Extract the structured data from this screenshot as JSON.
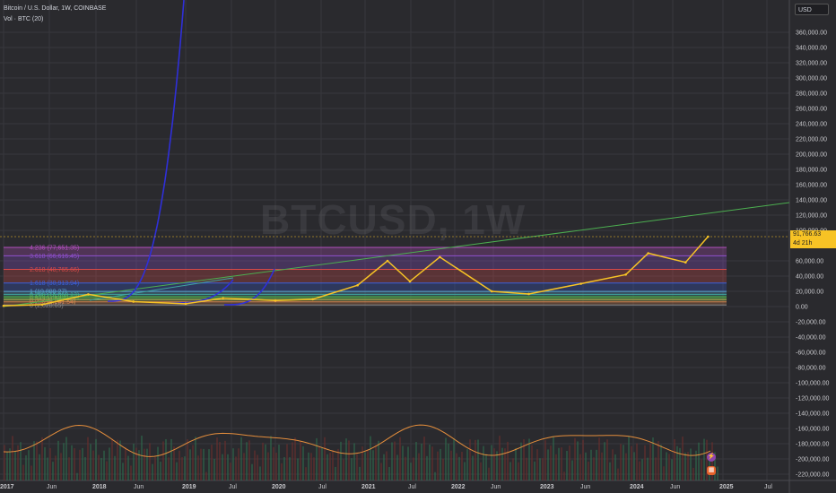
{
  "legend": {
    "symbol": "Bitcoin / U.S. Dollar, 1W, COINBASE",
    "indicator": "Vol · BTC (20)"
  },
  "watermark": "BTCUSD, 1W",
  "currency_button": "USD",
  "price_tag": {
    "price": "91,766.63",
    "countdown": "4d 21h"
  },
  "colors": {
    "background": "#2a2a2e",
    "price_line": "#f7c325",
    "volume_ma": "#e58e3c",
    "trend_line": "#4caf50",
    "parabola": "#2f2fd8"
  },
  "y_axis_labels": [
    "360,000.00",
    "340,000.00",
    "320,000.00",
    "300,000.00",
    "280,000.00",
    "260,000.00",
    "240,000.00",
    "220,000.00",
    "200,000.00",
    "180,000.00",
    "160,000.00",
    "140,000.00",
    "120,000.00",
    "100,000.00",
    "60,000.00",
    "40,000.00",
    "20,000.00",
    "0.00",
    "-20,000.00",
    "-40,000.00",
    "-60,000.00",
    "-80,000.00",
    "-100,000.00",
    "-120,000.00",
    "-140,000.00",
    "-160,000.00",
    "-180,000.00",
    "-200,000.00",
    "-220,000.00"
  ],
  "x_axis_labels": [
    "2017",
    "Jun",
    "2018",
    "Jun",
    "2019",
    "Jul",
    "2020",
    "Jul",
    "2021",
    "Jul",
    "2022",
    "Jun",
    "2023",
    "Jun",
    "2024",
    "Jun",
    "2025",
    "Jul"
  ],
  "fib_levels": [
    {
      "label": "4.236 (77,651.35)",
      "value": 77651.35,
      "color": "#b34fbf"
    },
    {
      "label": "3.618 (66,616.45)",
      "value": 66616.45,
      "color": "#8f4fcf"
    },
    {
      "label": "2.618 (48,765.66)",
      "value": 48765.66,
      "color": "#d84a4a"
    },
    {
      "label": "1.618 (30,913.94)",
      "value": 30913.94,
      "color": "#3b5fd9"
    },
    {
      "label": "1 (19,880.27)",
      "value": 19880.27,
      "color": "#5aa5d0"
    },
    {
      "label": "0.786 (16,060.13)",
      "value": 16060.13,
      "color": "#3fa5a0"
    },
    {
      "label": "0.618 (13,060.63)",
      "value": 13060.63,
      "color": "#4caf50"
    },
    {
      "label": "0.5 (10,954.2)",
      "value": 10954.2,
      "color": "#6aa84f"
    },
    {
      "label": "0.382 (8,847.78)",
      "value": 8847.78,
      "color": "#a0a04f"
    },
    {
      "label": "0.236 (6,241.54)",
      "value": 6241.54,
      "color": "#d0804f"
    },
    {
      "label": "0 (2,028.65)",
      "value": 2028.65,
      "color": "#888888"
    }
  ],
  "chart_data": {
    "type": "line",
    "title": "Bitcoin / U.S. Dollar, 1W, COINBASE",
    "series": [
      {
        "name": "BTCUSD",
        "x": [
          "2017-01",
          "2017-06",
          "2017-12",
          "2018-06",
          "2019-01",
          "2019-06",
          "2020-01",
          "2020-06",
          "2020-12",
          "2021-04",
          "2021-07",
          "2021-11",
          "2022-06",
          "2022-11",
          "2023-06",
          "2023-12",
          "2024-03",
          "2024-08",
          "2024-11"
        ],
        "values": [
          1000,
          2500,
          16000,
          6500,
          3700,
          11000,
          8000,
          9500,
          28000,
          60000,
          33000,
          65000,
          20000,
          16500,
          30000,
          42000,
          70000,
          58000,
          91766.63
        ]
      }
    ],
    "ylim": [
      -225000,
      370000
    ]
  }
}
